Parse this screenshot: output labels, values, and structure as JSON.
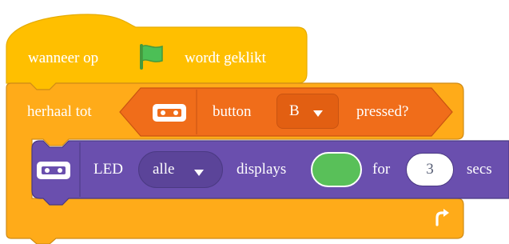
{
  "colors": {
    "events": "#FFBF00",
    "events_dark": "#E6AC00",
    "control": "#FFAB19",
    "control_dark": "#CF8B17",
    "sensing": "#F06D1A",
    "sensing_dark": "#C95411",
    "dropdown_sensing": "#E25F12",
    "extension": "#6A4FAE",
    "extension_dark": "#4B3A83",
    "dropdown_extension": "#5B4499",
    "led_color": "#59C059",
    "flag": "#4CBF56"
  },
  "icons": {
    "flag": "green-flag-icon",
    "microbit": "microbit-icon",
    "dropdown_arrow": "triangle-down-icon",
    "loop_arrow": "rotate-arrow-icon"
  },
  "hat_block": {
    "text_before": "wanneer op",
    "text_after": "wordt geklikt"
  },
  "repeat_block": {
    "label": "herhaal tot",
    "condition": {
      "text": "button",
      "button_value": "B",
      "text_after": "pressed?"
    }
  },
  "led_block": {
    "label": "LED",
    "target_value": "alle",
    "text_displays": "displays",
    "text_for": "for",
    "duration_value": "3",
    "text_secs": "secs"
  }
}
